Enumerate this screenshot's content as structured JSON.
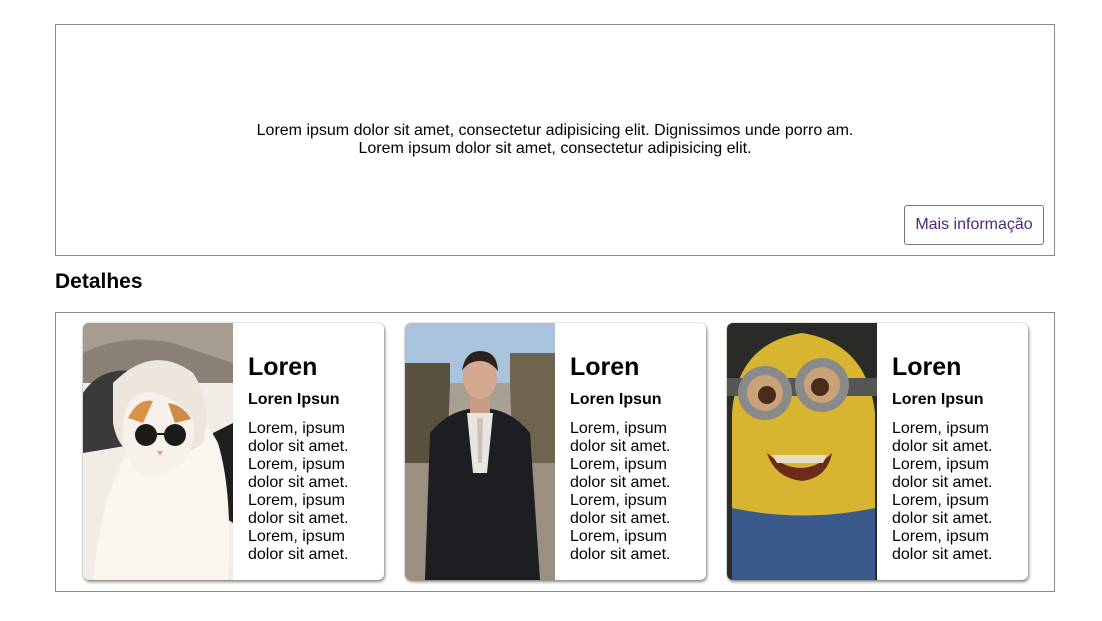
{
  "hero": {
    "line1": "Lorem ipsum dolor sit amet, consectetur adipisicing elit. Dignissimos unde porro am.",
    "line2": "Lorem ipsum dolor sit amet, consectetur adipisicing elit.",
    "button_label": "Mais informação"
  },
  "section": {
    "title": "Detalhes"
  },
  "cards": [
    {
      "image": "cat-with-sunglasses",
      "title": "Loren",
      "subtitle": "Loren Ipsun",
      "text": "Lorem, ipsum dolor sit amet. Lorem, ipsum dolor sit amet. Lorem, ipsum dolor sit amet. Lorem, ipsum dolor sit amet."
    },
    {
      "image": "man-in-suit",
      "title": "Loren",
      "subtitle": "Loren Ipsun",
      "text": "Lorem, ipsum dolor sit amet. Lorem, ipsum dolor sit amet. Lorem, ipsum dolor sit amet. Lorem, ipsum dolor sit amet."
    },
    {
      "image": "minion-statue",
      "title": "Loren",
      "subtitle": "Loren Ipsun",
      "text": "Lorem, ipsum dolor sit amet. Lorem, ipsum dolor sit amet. Lorem, ipsum dolor sit amet. Lorem, ipsum dolor sit amet."
    }
  ]
}
